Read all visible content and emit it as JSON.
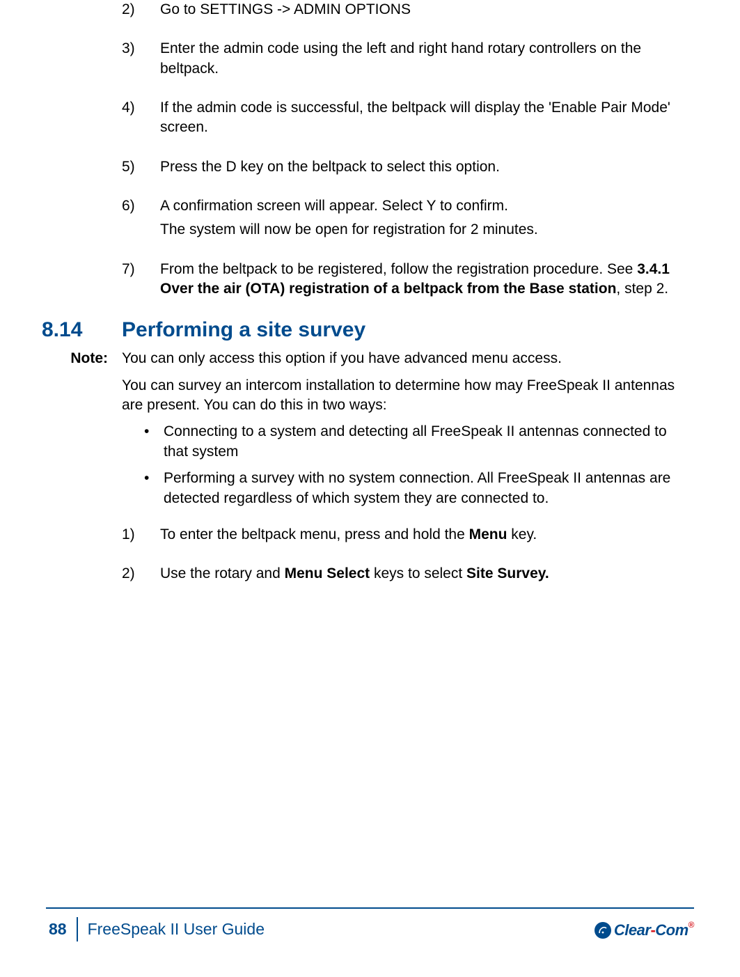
{
  "steps_a": [
    {
      "num": "2)",
      "lines": [
        "Go to SETTINGS -> ADMIN OPTIONS"
      ]
    },
    {
      "num": "3)",
      "lines": [
        "Enter the admin code using the left and right hand rotary controllers on the beltpack."
      ]
    },
    {
      "num": "4)",
      "lines": [
        "If the admin code is successful, the beltpack will display the 'Enable Pair Mode' screen."
      ]
    },
    {
      "num": "5)",
      "lines": [
        "Press the D key on the beltpack to select this option."
      ]
    },
    {
      "num": "6)",
      "lines": [
        "A confirmation screen will appear.  Select Y to confirm.",
        "The system will now be open for registration for 2 minutes."
      ]
    }
  ],
  "step7": {
    "num": "7)",
    "pre": "From the beltpack to be registered, follow the registration procedure. See ",
    "bold": "3.4.1 Over the air (OTA) registration of a beltpack from the Base station",
    "post": ", step 2."
  },
  "section": {
    "number": "8.14",
    "title": "Performing a site survey"
  },
  "note": {
    "label": "Note:",
    "text": "You can only access this option if you have advanced menu access."
  },
  "intro": "You can survey an intercom installation to determine how may FreeSpeak II antennas are present. You can do this in two ways:",
  "bullets": [
    "Connecting to a system and detecting all FreeSpeak II antennas connected to that system",
    "Performing a survey with no system connection. All FreeSpeak II antennas are detected regardless of which system they are connected to."
  ],
  "steps_b": [
    {
      "num": "1)",
      "pre": "To enter the beltpack menu, press and hold the ",
      "b1": "Menu",
      "mid": " key.",
      "b2": "",
      "post": ""
    },
    {
      "num": "2)",
      "pre": "Use the rotary and ",
      "b1": "Menu Select",
      "mid": " keys to select ",
      "b2": "Site Survey.",
      "post": ""
    }
  ],
  "footer": {
    "page": "88",
    "title": "FreeSpeak II User Guide",
    "logo_a": "Clear",
    "logo_sep": "-",
    "logo_b": "Com"
  }
}
